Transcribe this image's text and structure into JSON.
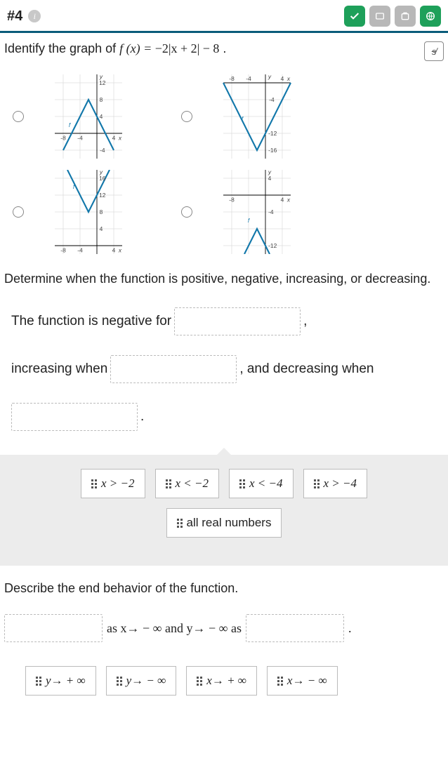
{
  "header": {
    "question_number": "#4",
    "info_icon": "i",
    "toolbar": {
      "check": "check-icon",
      "flag": "flag-icon",
      "share": "share-icon",
      "globe": "globe-icon"
    },
    "strike_tool": "s̸"
  },
  "prompt": {
    "lead": "Identify the graph of ",
    "func_lhs": "f (x) = ",
    "func_rhs": "−2|x + 2| − 8",
    "period": " ."
  },
  "graphs": {
    "a": {
      "ticks_x": [
        "-8",
        "-4",
        "4"
      ],
      "ticks_y": [
        "12",
        "8",
        "4",
        "-4"
      ],
      "f_label": "f",
      "axis_x": "x",
      "axis_y": "y"
    },
    "b": {
      "ticks_x": [
        "-8",
        "-4",
        "4"
      ],
      "ticks_y": [
        "-4",
        "-12",
        "-16"
      ],
      "f_label": "f",
      "axis_x": "x",
      "axis_y": "y"
    },
    "c": {
      "ticks_x": [
        "-8",
        "-4",
        "4"
      ],
      "ticks_y": [
        "16",
        "12",
        "8",
        "4"
      ],
      "f_label": "f",
      "axis_x": "x",
      "axis_y": "y"
    },
    "d": {
      "ticks_x": [
        "-8",
        "4"
      ],
      "ticks_y": [
        "4",
        "-4",
        "-12"
      ],
      "f_label": "f",
      "axis_x": "x",
      "axis_y": "y"
    }
  },
  "sub_prompt": "Determine when the function is positive, negative, increasing, or decreasing.",
  "fill": {
    "line1_prefix": "The function is negative for ",
    "line2_prefix": "increasing when ",
    "line2_mid": ", and decreasing when",
    "line3_suffix": "."
  },
  "bank1": {
    "opt1": "x > −2",
    "opt2": "x < −2",
    "opt3": "x < −4",
    "opt4": "x > −4",
    "opt5": "all real numbers"
  },
  "end_behavior": {
    "label": "Describe the end behavior of the function.",
    "mid1": "as x→ − ∞ and y→ − ∞ as",
    "period": "."
  },
  "bank2": {
    "opt1": "y→ + ∞",
    "opt2": "y→ − ∞",
    "opt3": "x→ + ∞",
    "opt4": "x→ − ∞"
  },
  "chart_data": [
    {
      "type": "line",
      "title": "Option A",
      "formula": "f(x) = -2|x+2| + 8",
      "vertex": [
        -2,
        8
      ],
      "xlim": [
        -10,
        6
      ],
      "ylim": [
        -6,
        14
      ],
      "series": [
        {
          "name": "f",
          "x": [
            -8,
            -2,
            4
          ],
          "y": [
            -4,
            8,
            -4
          ]
        }
      ]
    },
    {
      "type": "line",
      "title": "Option B",
      "formula": "f(x) = 2|x+2| - 16",
      "vertex": [
        -2,
        -16
      ],
      "xlim": [
        -10,
        6
      ],
      "ylim": [
        -18,
        2
      ],
      "series": [
        {
          "name": "f",
          "x": [
            -10,
            -2,
            6
          ],
          "y": [
            0,
            -16,
            0
          ]
        }
      ]
    },
    {
      "type": "line",
      "title": "Option C",
      "formula": "f(x) = 2|x+2| + 8",
      "vertex": [
        -2,
        8
      ],
      "xlim": [
        -10,
        6
      ],
      "ylim": [
        -2,
        18
      ],
      "series": [
        {
          "name": "f",
          "x": [
            -7,
            -2,
            3
          ],
          "y": [
            18,
            8,
            18
          ]
        }
      ]
    },
    {
      "type": "line",
      "title": "Option D",
      "formula": "f(x) = -2|x+2| - 8",
      "vertex": [
        -2,
        -8
      ],
      "xlim": [
        -10,
        6
      ],
      "ylim": [
        -14,
        6
      ],
      "series": [
        {
          "name": "f",
          "x": [
            -5,
            -2,
            1
          ],
          "y": [
            -14,
            -8,
            -14
          ]
        }
      ]
    }
  ]
}
